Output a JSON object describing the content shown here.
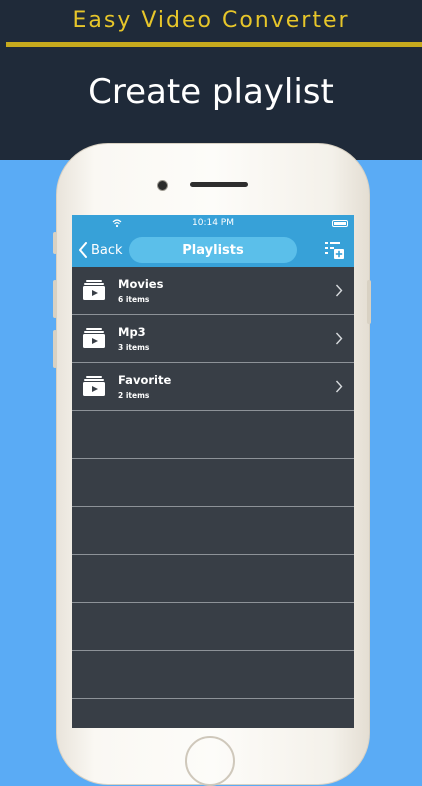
{
  "banner": {
    "app_name": "Easy Video Converter",
    "tagline": "Create playlist"
  },
  "status_bar": {
    "time": "10:14 PM"
  },
  "nav": {
    "back_label": "Back",
    "title": "Playlists"
  },
  "playlists": [
    {
      "name": "Movies",
      "count": "6 items"
    },
    {
      "name": "Mp3",
      "count": "3 items"
    },
    {
      "name": "Favorite",
      "count": "2 items"
    }
  ],
  "colors": {
    "banner_bg": "#1f2a39",
    "brand_gold": "#e7c62a",
    "page_bg": "#5aabf5",
    "nav_blue": "#37a1d8",
    "list_bg": "#383e46"
  },
  "icons": {
    "wifi": "wifi-icon",
    "battery": "battery-icon",
    "back": "chevron-left-icon",
    "add_playlist": "add-playlist-icon",
    "folder": "video-folder-icon",
    "disclosure": "chevron-right-icon"
  }
}
